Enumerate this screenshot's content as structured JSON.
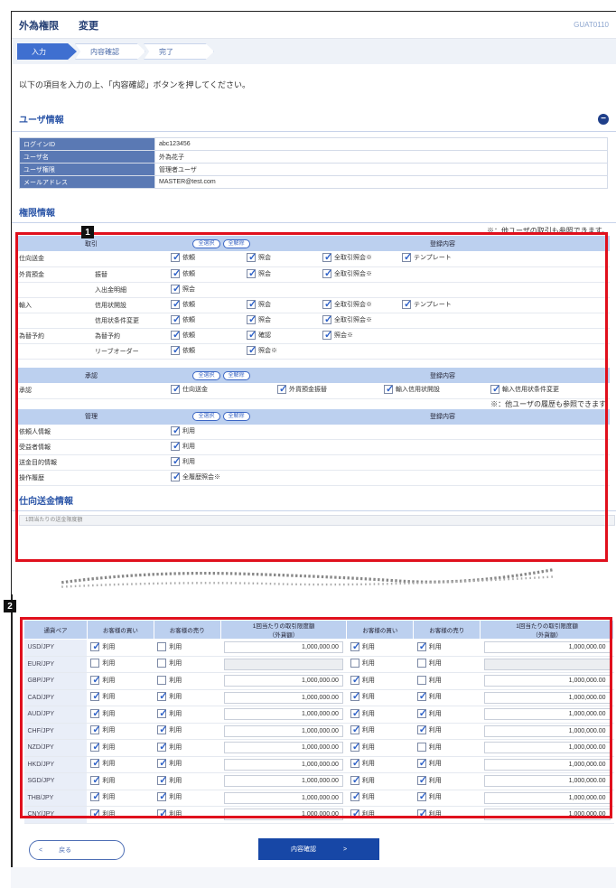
{
  "header": {
    "title": "外為権限",
    "subtitle": "変更",
    "screen_code": "GUAT0110"
  },
  "steps": [
    {
      "label": "入力"
    },
    {
      "label": "内容確認"
    },
    {
      "label": "完了"
    }
  ],
  "lead_text": "以下の項目を入力の上、「内容確認」ボタンを押してください。",
  "user_info": {
    "title": "ユーザ情報",
    "collapse_icon": "minus-circle-icon",
    "rows": [
      {
        "key": "ログインID",
        "value": "abc123456"
      },
      {
        "key": "ユーザ名",
        "value": "外為花子"
      },
      {
        "key": "ユーザ権限",
        "value": "管理者ユーザ"
      },
      {
        "key": "メールアドレス",
        "value": "MASTER@test.com"
      }
    ]
  },
  "perm_info": {
    "title": "権限情報",
    "note1": "※：他ユーザの取引も参照できます。",
    "note2": "※：他ユーザの履歴も参照できます",
    "select_all": "全選択",
    "deselect_all": "全解除",
    "col_trade": "取引",
    "col_detail": "登録内容",
    "col_approve": "承認",
    "col_manage": "管理",
    "trade_rows": [
      {
        "cat": "仕向送金",
        "sub": "",
        "items": [
          [
            "依頼",
            true
          ],
          [
            "照会",
            true
          ],
          [
            "全取引照会※",
            true
          ],
          [
            "テンプレート",
            true
          ]
        ]
      },
      {
        "cat": "外貨預金",
        "sub": "振替",
        "items": [
          [
            "依頼",
            true
          ],
          [
            "照会",
            true
          ],
          [
            "全取引照会※",
            true
          ]
        ]
      },
      {
        "cat": "",
        "sub": "入出金明細",
        "items": [
          [
            "照会",
            true
          ]
        ]
      },
      {
        "cat": "輸入",
        "sub": "信用状開設",
        "items": [
          [
            "依頼",
            true
          ],
          [
            "照会",
            true
          ],
          [
            "全取引照会※",
            true
          ],
          [
            "テンプレート",
            true
          ]
        ]
      },
      {
        "cat": "",
        "sub": "信用状条件変更",
        "items": [
          [
            "依頼",
            true
          ],
          [
            "照会",
            true
          ],
          [
            "全取引照会※",
            true
          ]
        ]
      },
      {
        "cat": "為替予約",
        "sub": "為替予約",
        "items": [
          [
            "依頼",
            true
          ],
          [
            "確認",
            true
          ],
          [
            "照会※",
            true
          ]
        ]
      },
      {
        "cat": "",
        "sub": "リーブオーダー",
        "items": [
          [
            "依頼",
            true
          ],
          [
            "照会※",
            true
          ]
        ]
      }
    ],
    "approve_row": {
      "cat": "承認",
      "items": [
        [
          "仕向送金",
          true
        ],
        [
          "外貨預金振替",
          true
        ],
        [
          "輸入信用状開設",
          true
        ],
        [
          "輸入信用状条件変更",
          true
        ]
      ]
    },
    "manage_rows": [
      {
        "cat": "依頼人情報",
        "items": [
          [
            "利用",
            true
          ]
        ]
      },
      {
        "cat": "受益者情報",
        "items": [
          [
            "利用",
            true
          ]
        ]
      },
      {
        "cat": "送金目的情報",
        "items": [
          [
            "利用",
            true
          ]
        ]
      },
      {
        "cat": "操作履歴",
        "items": [
          [
            "全履歴照会※",
            true
          ]
        ]
      }
    ]
  },
  "remit_section": {
    "title": "仕向送金情報",
    "first_row": "1回当たりの送金限度額"
  },
  "fx_table": {
    "headers": {
      "pair": "通貨ペア",
      "buy": "お客様の買い",
      "sell": "お客様の売り",
      "limit": "1回当たりの取引限度額",
      "limit_unit": "（外貨額）"
    },
    "use_label": "利用",
    "rows": [
      {
        "pair": "USD/JPY",
        "l_buy": true,
        "l_sell": false,
        "l_limit": "1,000,000.00",
        "r_buy": true,
        "r_sell": true,
        "r_limit": "1,000,000.00"
      },
      {
        "pair": "EUR/JPY",
        "l_buy": false,
        "l_sell": false,
        "l_limit": "",
        "r_buy": false,
        "r_sell": false,
        "r_limit": ""
      },
      {
        "pair": "GBP/JPY",
        "l_buy": true,
        "l_sell": false,
        "l_limit": "1,000,000.00",
        "r_buy": true,
        "r_sell": false,
        "r_limit": "1,000,000.00"
      },
      {
        "pair": "CAD/JPY",
        "l_buy": true,
        "l_sell": true,
        "l_limit": "1,000,000.00",
        "r_buy": true,
        "r_sell": true,
        "r_limit": "1,000,000.00"
      },
      {
        "pair": "AUD/JPY",
        "l_buy": true,
        "l_sell": true,
        "l_limit": "1,000,000.00",
        "r_buy": true,
        "r_sell": true,
        "r_limit": "1,000,000.00"
      },
      {
        "pair": "CHF/JPY",
        "l_buy": true,
        "l_sell": true,
        "l_limit": "1,000,000.00",
        "r_buy": true,
        "r_sell": true,
        "r_limit": "1,000,000.00"
      },
      {
        "pair": "NZD/JPY",
        "l_buy": true,
        "l_sell": true,
        "l_limit": "1,000,000.00",
        "r_buy": true,
        "r_sell": false,
        "r_limit": "1,000,000.00"
      },
      {
        "pair": "HKD/JPY",
        "l_buy": true,
        "l_sell": true,
        "l_limit": "1,000,000.00",
        "r_buy": true,
        "r_sell": true,
        "r_limit": "1,000,000.00"
      },
      {
        "pair": "SGD/JPY",
        "l_buy": true,
        "l_sell": true,
        "l_limit": "1,000,000.00",
        "r_buy": true,
        "r_sell": true,
        "r_limit": "1,000,000.00"
      },
      {
        "pair": "THB/JPY",
        "l_buy": true,
        "l_sell": true,
        "l_limit": "1,000,000.00",
        "r_buy": true,
        "r_sell": true,
        "r_limit": "1,000,000.00"
      },
      {
        "pair": "CNY/JPY",
        "l_buy": true,
        "l_sell": true,
        "l_limit": "1,000,000.00",
        "r_buy": true,
        "r_sell": true,
        "r_limit": "1,000,000.00"
      }
    ]
  },
  "markers": [
    "1",
    "2"
  ],
  "buttons": {
    "back": "戻る",
    "back_icon": "<",
    "next": "内容確認",
    "next_icon": ">"
  }
}
